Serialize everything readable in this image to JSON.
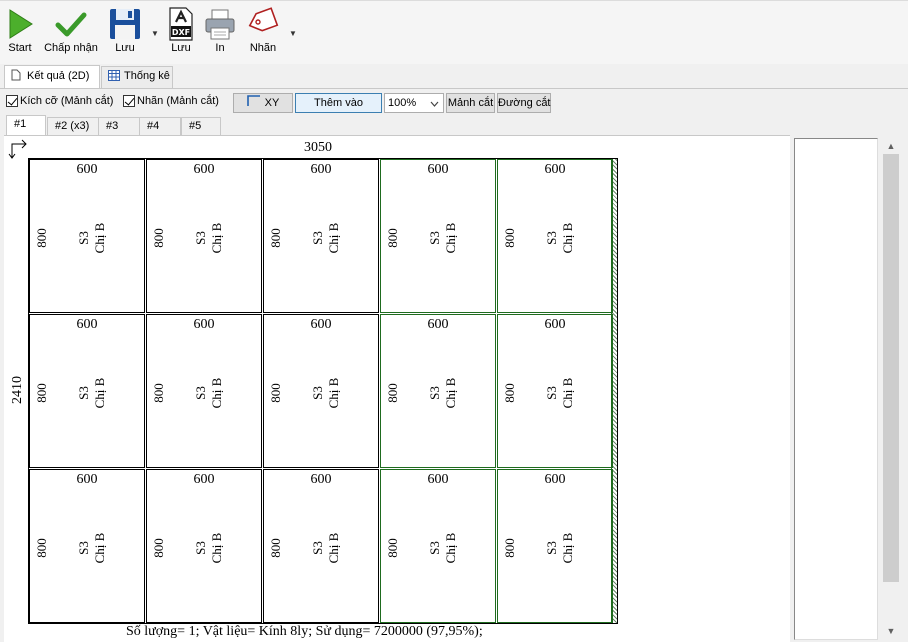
{
  "toolbar": {
    "start_label": "Start",
    "accept_label": "Chấp nhận",
    "save_label": "Lưu",
    "dxf_label": "Lưu",
    "dxf_badge": "DXF",
    "print_label": "In",
    "tag_label": "Nhãn"
  },
  "view_tabs": [
    {
      "label": "Kết quả (2D)",
      "active": true
    },
    {
      "label": "Thống kê",
      "active": false
    }
  ],
  "options": {
    "size_check_label": "Kích cỡ (Mảnh cắt)",
    "size_checked": true,
    "label_check_label": "Nhãn (Mảnh cắt)",
    "label_checked": true,
    "xy_label": "XY",
    "add_label": "Thêm vào",
    "zoom_value": "100%",
    "pieces_label": "Mảnh cắt",
    "cutlines_label": "Đường cắt"
  },
  "sheet_tabs": [
    "#1",
    "#2 (x3)",
    "#3",
    "#4",
    "#5"
  ],
  "sheet": {
    "width": "3050",
    "height": "2410",
    "rows": 3,
    "cols": 5,
    "piece_width": "600",
    "piece_height": "800",
    "piece_label1": "S3",
    "piece_label2": "Chị B",
    "status": "Số lượng= 1; Vật liệu= Kính 8ly; Sử dụng= 7200000 (97,95%);"
  },
  "colors": {
    "cut_green": "#1e6b1e",
    "accent_blue": "#3c7fb1"
  }
}
